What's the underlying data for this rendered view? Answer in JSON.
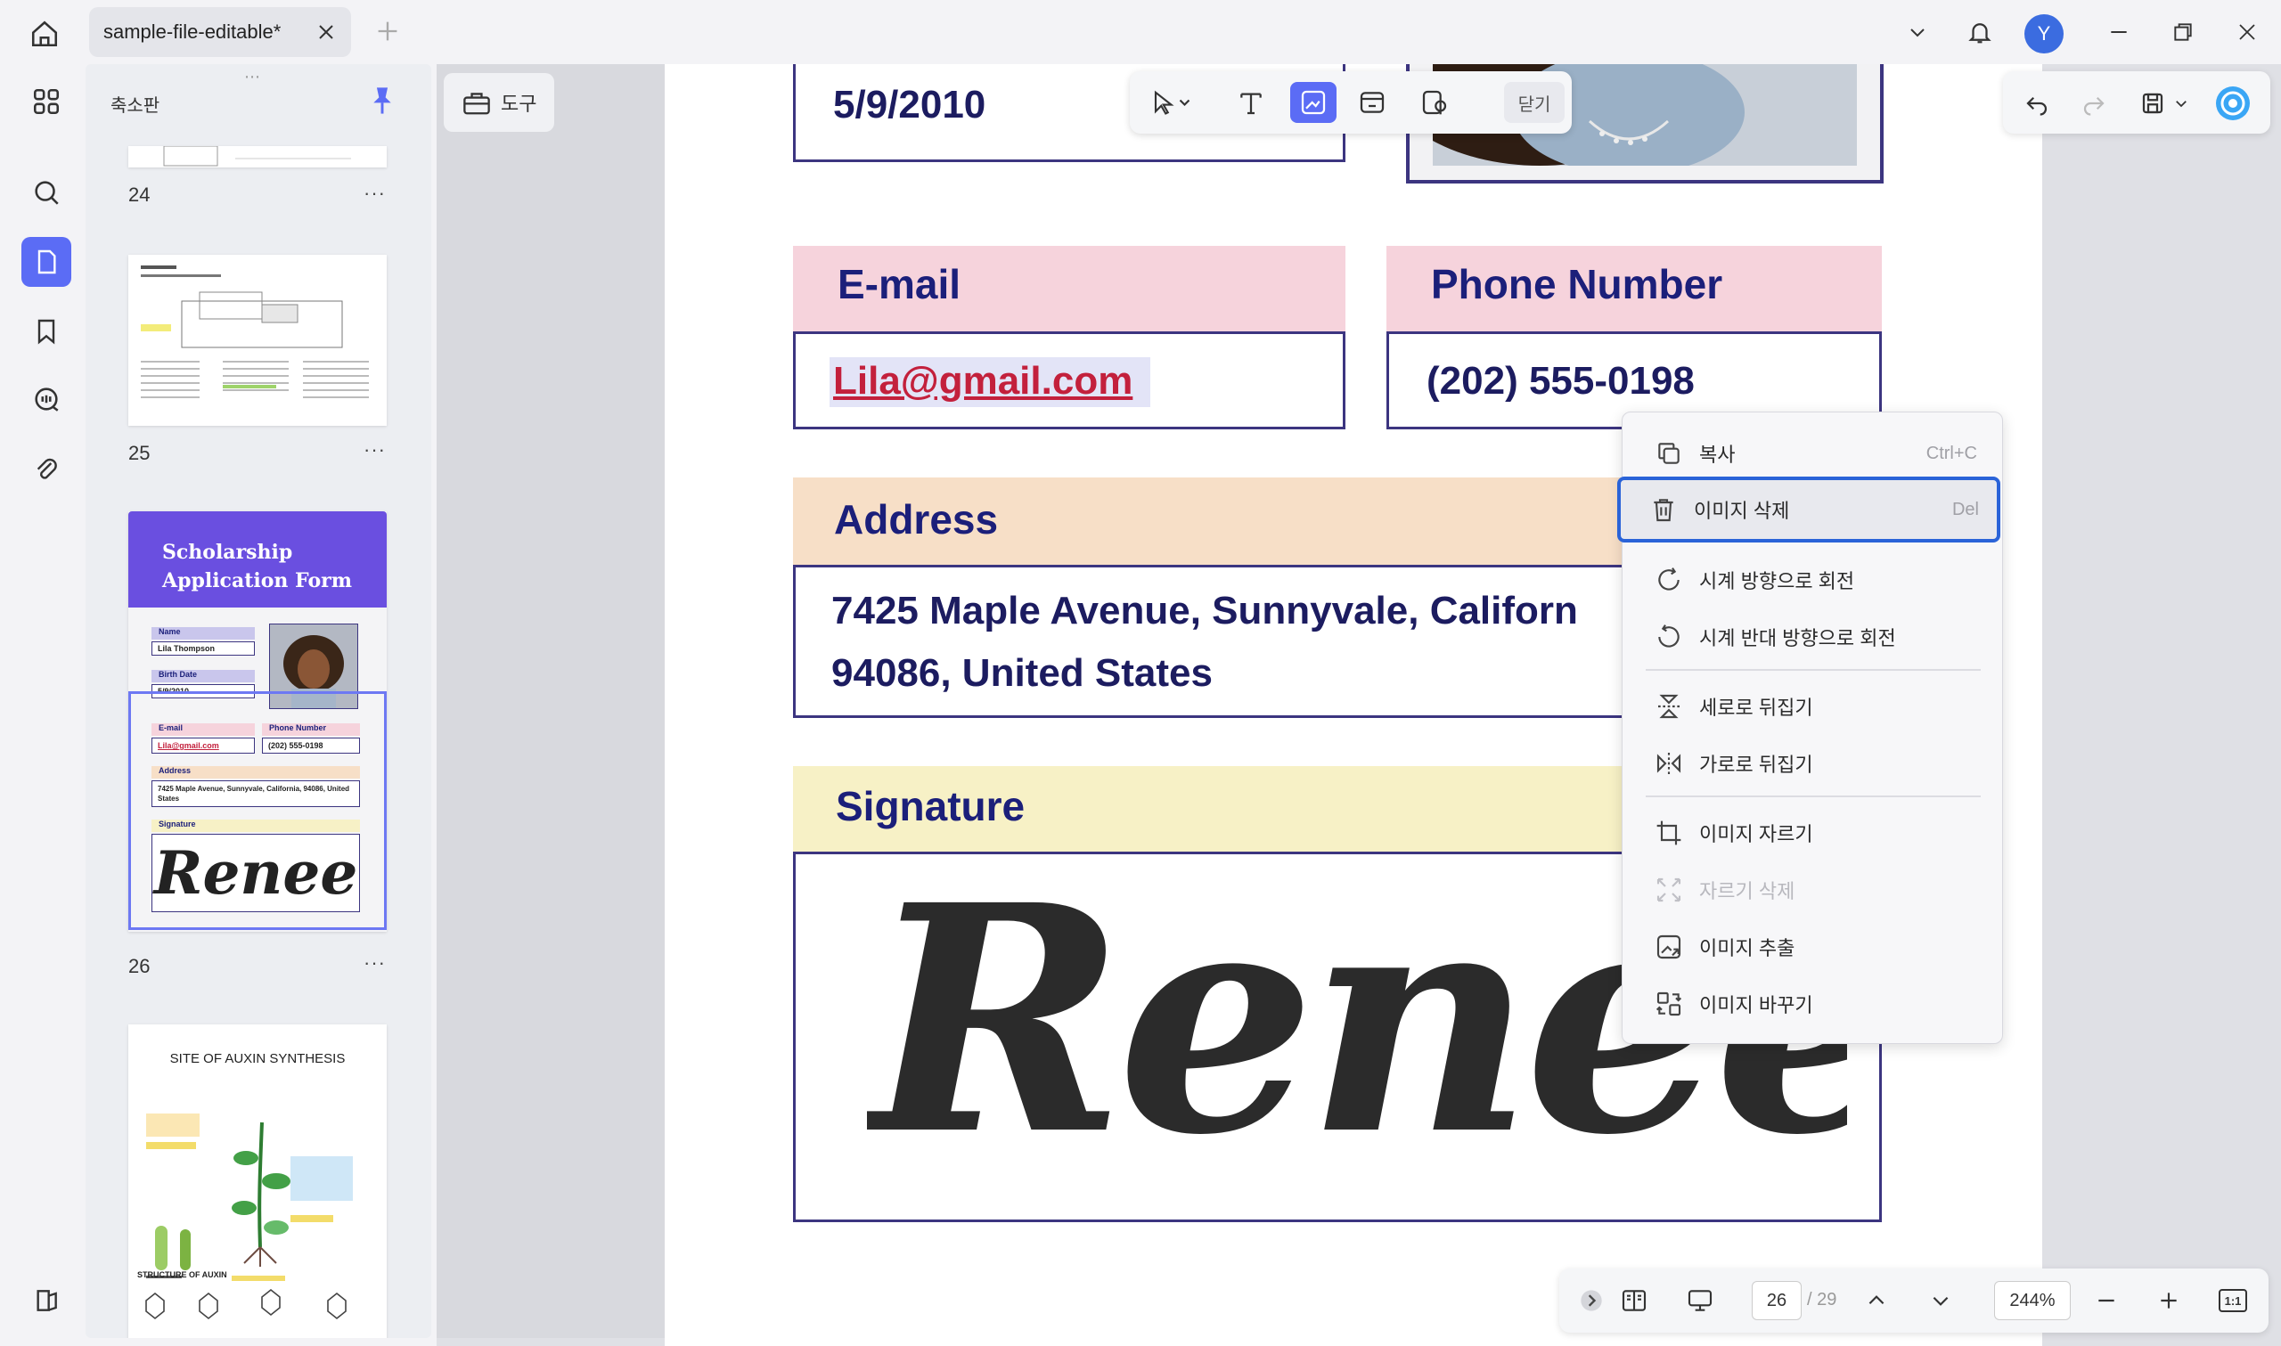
{
  "titlebar": {
    "tab_title": "sample-file-editable*",
    "avatar_letter": "Y"
  },
  "thumbnails": {
    "panel_title": "축소판",
    "pages": [
      {
        "number": "24"
      },
      {
        "number": "25"
      },
      {
        "number": "26"
      },
      {
        "number": ""
      }
    ],
    "more_label": "···",
    "page26": {
      "header": "Scholarship Application Form",
      "name_label": "Name",
      "name_value": "Lila Thompson",
      "birth_label": "Birth Date",
      "birth_value": "5/9/2010",
      "email_label": "E-mail",
      "email_value": "Lila@gmail.com",
      "phone_label": "Phone Number",
      "phone_value": "(202) 555-0198",
      "address_label": "Address",
      "address_value": "7425 Maple Avenue, Sunnyvale, California, 94086, United States",
      "signature_label": "Signature",
      "signature_value": "Renee"
    },
    "page27": {
      "title": "SITE OF AUXIN SYNTHESIS",
      "footer": "STRUCTURE OF AUXIN"
    }
  },
  "toolbar": {
    "tools_label": "도구",
    "close_label": "닫기"
  },
  "document": {
    "birth_date": "5/9/2010",
    "email_label": "E-mail",
    "email_value": "Lila@gmail.com",
    "phone_label": "Phone Number",
    "phone_value": "(202) 555-0198",
    "address_label": "Address",
    "address_line1": "7425 Maple Avenue, Sunnyvale, Californ",
    "address_line2": "94086, United States",
    "signature_label": "Signature",
    "signature_value": "Renee"
  },
  "context_menu": {
    "items": [
      {
        "label": "복사",
        "shortcut": "Ctrl+C"
      },
      {
        "label": "이미지 삭제",
        "shortcut": "Del"
      },
      {
        "label": "시계 방향으로 회전"
      },
      {
        "label": "시계 반대 방향으로 회전"
      },
      {
        "label": "세로로 뒤집기"
      },
      {
        "label": "가로로 뒤집기"
      },
      {
        "label": "이미지 자르기"
      },
      {
        "label": "자르기 삭제"
      },
      {
        "label": "이미지 추출"
      },
      {
        "label": "이미지 바꾸기"
      }
    ]
  },
  "bottom_bar": {
    "current_page": "26",
    "total_pages": "/ 29",
    "zoom": "244%",
    "actual_size": "1:1"
  },
  "colors": {
    "accent": "#5b6cf5",
    "highlight_border": "#2a63d8",
    "email_header": "#f6d3dc",
    "phone_header": "#f6d3dc",
    "address_header": "#f7dfc7",
    "signature_header": "#f7f1c6",
    "field_border": "#3c3580",
    "form_header_purple": "#6a4fe0"
  }
}
